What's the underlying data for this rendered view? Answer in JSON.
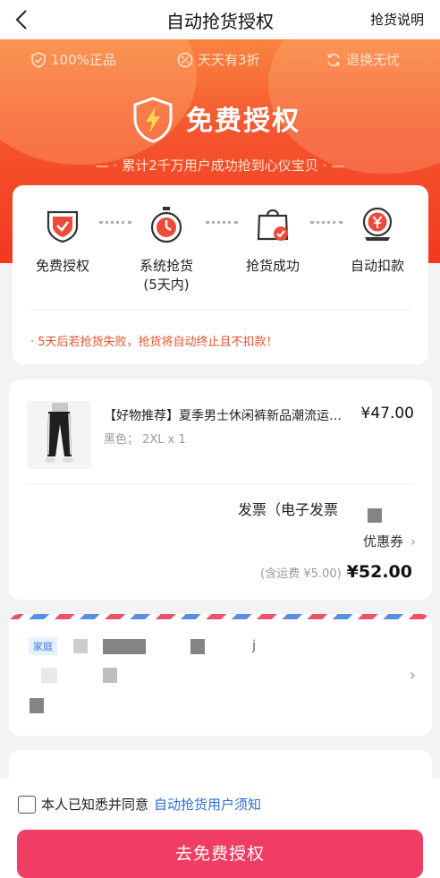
{
  "nav": {
    "title": "自动抢货授权",
    "explain_label": "抢货说明",
    "back_icon": "chevron-left-icon"
  },
  "hero": {
    "badges": [
      {
        "icon": "shield-check-icon",
        "label": "100%正品"
      },
      {
        "icon": "percent-icon",
        "label": "天天有3折"
      },
      {
        "icon": "refresh-icon",
        "label": "退换无忧"
      }
    ],
    "title": "免费授权",
    "subtitle": "— · 累计2千万用户成功抢到心仪宝贝 · —"
  },
  "steps": {
    "items": [
      {
        "icon": "shield-check-icon",
        "label": "免费授权",
        "sub": ""
      },
      {
        "icon": "stopwatch-icon",
        "label": "系统抢货",
        "sub": "(5天内)"
      },
      {
        "icon": "shopping-bag-icon",
        "label": "抢货成功",
        "sub": ""
      },
      {
        "icon": "yen-coin-icon",
        "label": "自动扣款",
        "sub": ""
      }
    ],
    "warning": "· 5天后若抢货失败，抢货将自动终止且不扣款！"
  },
  "order": {
    "product_name": "【好物推荐】夏季男士休闲裤新品潮流运动裤",
    "price": "¥47.00",
    "sku": "黑色； 2XL x 1",
    "invoice_label": "发票（电子发票",
    "coupon_label": "优惠券",
    "shipping_note": "(含运费 ¥5.00)",
    "total": "¥52.00"
  },
  "address": {
    "tag": "家庭",
    "partial_text": "j"
  },
  "bottom": {
    "agree_text": "本人已知悉并同意",
    "agree_link": "自动抢货用户须知",
    "cta_label": "去免费授权"
  },
  "colors": {
    "accent": "#f1381f",
    "cta": "#ef3d63",
    "link": "#2f6bd6",
    "warning": "#e8532b"
  }
}
